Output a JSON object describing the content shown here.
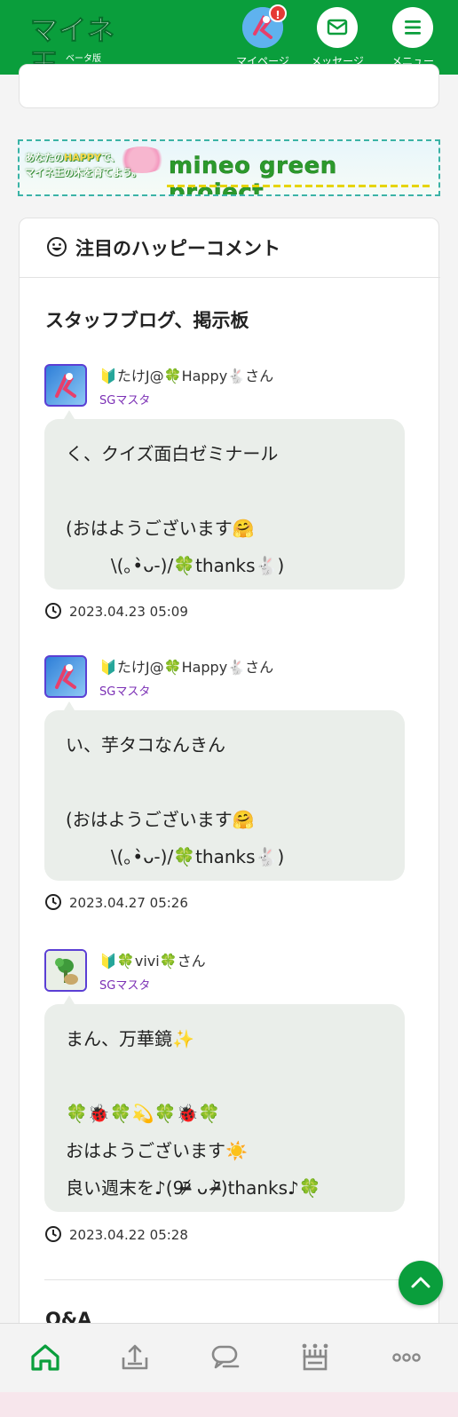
{
  "header": {
    "logo_text": "マイネ王",
    "logo_sub": "ベータ版",
    "nav": [
      {
        "label": "マイページ",
        "badge": "!"
      },
      {
        "label": "メッセージ"
      },
      {
        "label": "メニュー"
      }
    ]
  },
  "banner": {
    "left_line1": "あなたのHAPPYで、",
    "left_happy": "HAPPY",
    "left_pre": "あなたの",
    "left_post": "で、",
    "left_line2": "マイネ王の木を育てよう。",
    "title": "mineo green project"
  },
  "card": {
    "title": "注目のハッピーコメント",
    "section": "スタッフブログ、掲示板",
    "comments": [
      {
        "user": "🔰たけJ@🍀Happy🐇さん",
        "role": "SGマスタ",
        "lines": [
          "く、クイズ面白ゼミナール",
          "",
          "(おはようございます🤗",
          "        \\(｡•̀ᴗ-)/🍀thanks🐇)"
        ],
        "time": "2023.04.23 05:09"
      },
      {
        "user": "🔰たけJ@🍀Happy🐇さん",
        "role": "SGマスタ",
        "lines": [
          "い、芋タコなんきん",
          "",
          "(おはようございます🤗",
          "        \\(｡•̀ᴗ-)/🍀thanks🐇)"
        ],
        "time": "2023.04.27 05:26"
      },
      {
        "user": "🔰🍀vivi🍀さん",
        "role": "SGマスタ",
        "lines": [
          "まん、万華鏡✨",
          "",
          "🍀🐞🍀💫🍀🐞🍀",
          "おはようございます☀️",
          "良い週末を♪(9ᵒ̴̶̷᷄ ᴗ ᵒ̴̶̷᷅)thanks♪🍀"
        ],
        "time": "2023.04.22 05:28"
      }
    ],
    "next_section": "Q&A"
  },
  "bottom_nav": [
    "home-icon",
    "upload-icon",
    "chat-icon",
    "crown-icon",
    "more-icon"
  ],
  "colors": {
    "brand": "#0a9e3c",
    "bubble": "#eaeeea",
    "role": "#7b2fb5",
    "avatar_border": "#5b3fd4"
  }
}
